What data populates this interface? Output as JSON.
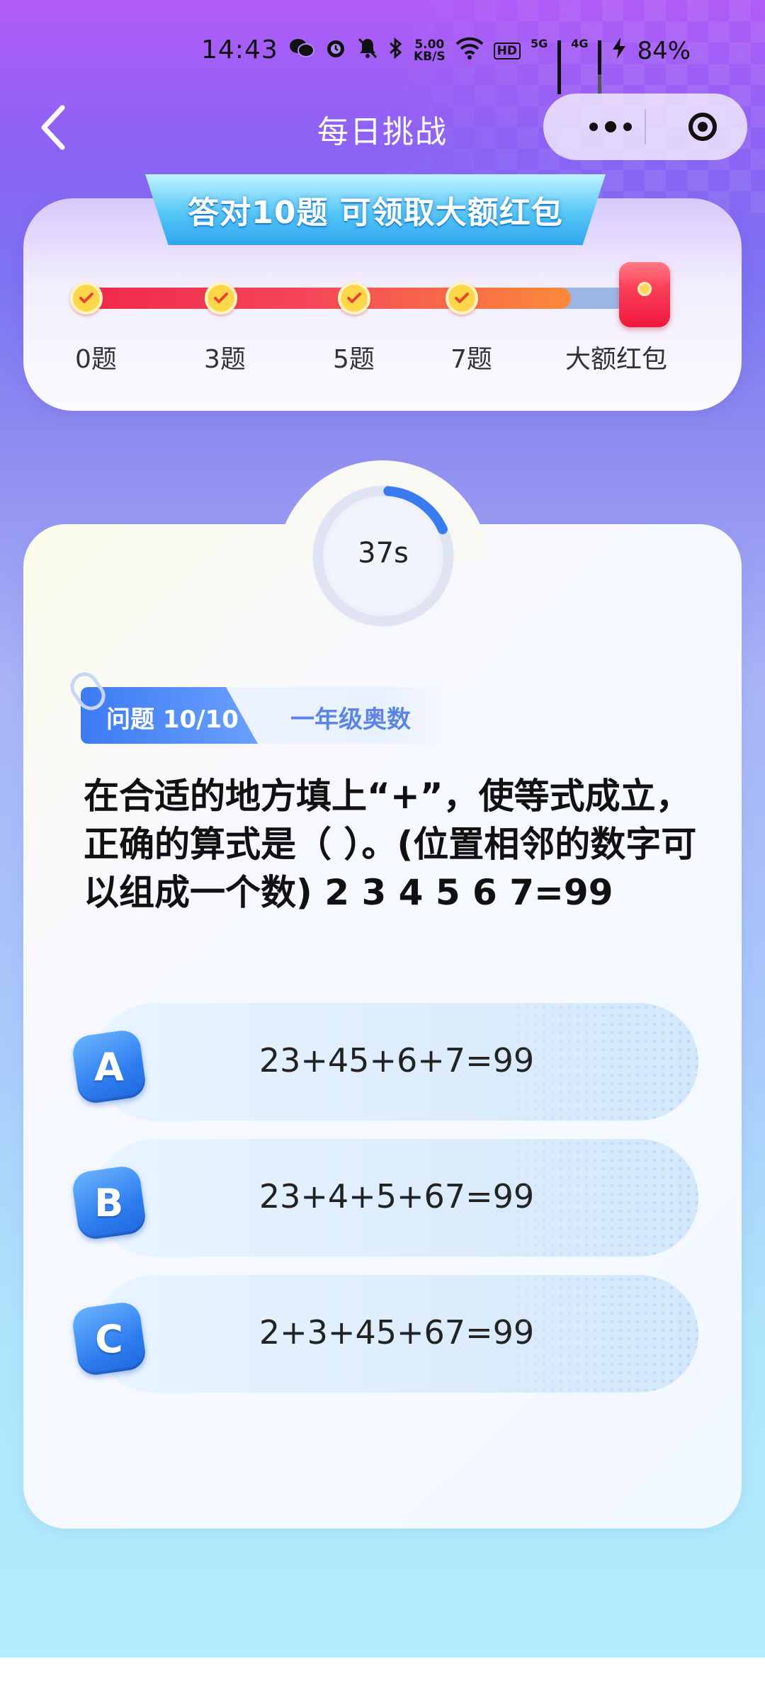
{
  "status_bar": {
    "time": "14:43",
    "speed_value": "5.00",
    "speed_unit": "KB/S",
    "hd_label": "HD",
    "net1": "5G",
    "net2": "4G",
    "battery": "84%",
    "icons": [
      "wechat-icon",
      "alarm-icon",
      "mute-icon",
      "bluetooth-icon",
      "wifi-icon",
      "signal-icon",
      "charging-icon"
    ]
  },
  "nav": {
    "title": "每日挑战"
  },
  "progress": {
    "banner": "答对10题 可领取大额红包",
    "completed_fraction": 0.85,
    "stops": [
      {
        "label": "0题",
        "done": true
      },
      {
        "label": "3题",
        "done": true
      },
      {
        "label": "5题",
        "done": true
      },
      {
        "label": "7题",
        "done": true
      },
      {
        "label": "大额红包",
        "done": false
      }
    ]
  },
  "timer": {
    "text": "37s",
    "remaining_fraction": 0.17
  },
  "question": {
    "number_label": "问题 10/10",
    "category": "一年级奥数",
    "text": "在合适的地方填上“+”，使等式成立，正确的算式是（ ）。(位置相邻的数字可以组成一个数) 2 3 4 5 6 7=99"
  },
  "options": [
    {
      "letter": "A",
      "text": "23+45+6+7=99"
    },
    {
      "letter": "B",
      "text": "23+4+5+67=99"
    },
    {
      "letter": "C",
      "text": "2+3+45+67=99"
    }
  ],
  "colors": {
    "accent_blue": "#2f7ff0",
    "progress_red": "#f0294a",
    "progress_orange": "#fb8a3a",
    "check_yellow": "#fdd64a"
  }
}
